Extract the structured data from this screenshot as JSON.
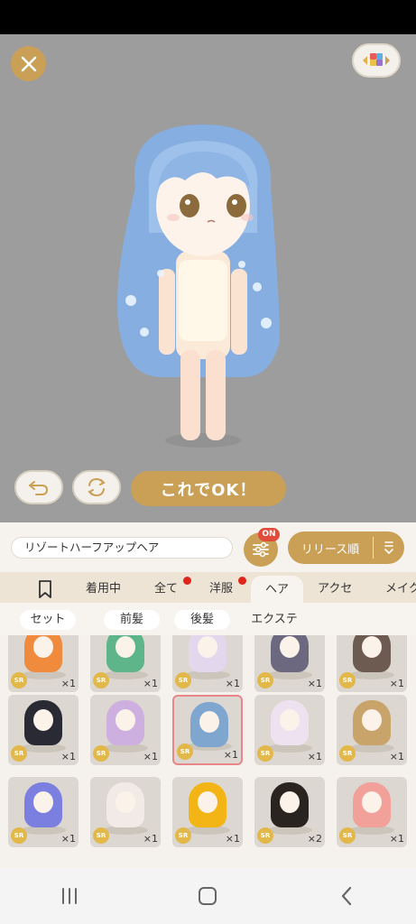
{
  "stage": {
    "ok_button": "これでOK！"
  },
  "search": {
    "item_name": "リゾートハーフアップヘア",
    "filter_badge": "ON",
    "sort_label": "リリース順"
  },
  "category_tabs": [
    {
      "label": "着用中",
      "dot": false
    },
    {
      "label": "全て",
      "dot": true
    },
    {
      "label": "洋服",
      "dot": true
    },
    {
      "label": "ヘア",
      "dot": false,
      "active": true
    },
    {
      "label": "アクセ",
      "dot": false
    },
    {
      "label": "メイク",
      "dot": false
    }
  ],
  "sub_tabs": [
    "セット",
    "前髪",
    "後髪",
    "エクステ"
  ],
  "items": [
    {
      "rarity": "SR",
      "qty": "×1",
      "color": "#f08a3c"
    },
    {
      "rarity": "SR",
      "qty": "×1",
      "color": "#5fb58a"
    },
    {
      "rarity": "SR",
      "qty": "×1",
      "color": "#e3d7ee"
    },
    {
      "rarity": "SR",
      "qty": "×1",
      "color": "#6b6880"
    },
    {
      "rarity": "SR",
      "qty": "×1",
      "color": "#6d5a50"
    },
    {
      "rarity": "SR",
      "qty": "×1",
      "color": "#2a2a35"
    },
    {
      "rarity": "SR",
      "qty": "×1",
      "color": "#cdb0e0"
    },
    {
      "rarity": "SR",
      "qty": "×1",
      "color": "#7ea6cf"
    },
    {
      "rarity": "SR",
      "qty": "×1",
      "color": "#efe2f0"
    },
    {
      "rarity": "SR",
      "qty": "×1",
      "color": "#c9a46a"
    },
    {
      "rarity": "SR",
      "qty": "×1",
      "color": "#7b7fe0"
    },
    {
      "rarity": "SR",
      "qty": "×1",
      "color": "#f1eae6"
    },
    {
      "rarity": "SR",
      "qty": "×1",
      "color": "#f2b515"
    },
    {
      "rarity": "SR",
      "qty": "×2",
      "color": "#2a2420"
    },
    {
      "rarity": "SR",
      "qty": "×1",
      "color": "#f2a09a"
    }
  ],
  "colors": {
    "accent": "#c9a056",
    "selected_border": "#e8868a",
    "badge_red": "#e24a3a"
  }
}
